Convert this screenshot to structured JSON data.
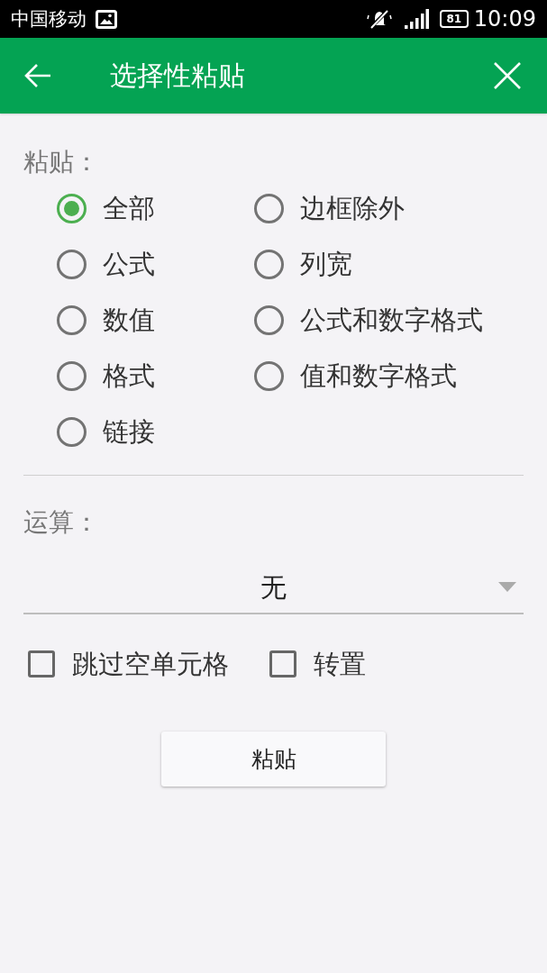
{
  "status_bar": {
    "carrier": "中国移动",
    "battery": "81",
    "time": "10:09"
  },
  "header": {
    "title": "选择性粘贴"
  },
  "paste_section": {
    "label": "粘贴：",
    "options": [
      {
        "label": "全部",
        "selected": true
      },
      {
        "label": "边框除外",
        "selected": false
      },
      {
        "label": "公式",
        "selected": false
      },
      {
        "label": "列宽",
        "selected": false
      },
      {
        "label": "数值",
        "selected": false
      },
      {
        "label": "公式和数字格式",
        "selected": false
      },
      {
        "label": "格式",
        "selected": false
      },
      {
        "label": "值和数字格式",
        "selected": false
      },
      {
        "label": "链接",
        "selected": false
      }
    ]
  },
  "operation_section": {
    "label": "运算：",
    "dropdown": {
      "value": "无"
    }
  },
  "checkboxes": [
    {
      "label": "跳过空单元格",
      "checked": false
    },
    {
      "label": "转置",
      "checked": false
    }
  ],
  "button": {
    "label": "粘贴"
  }
}
